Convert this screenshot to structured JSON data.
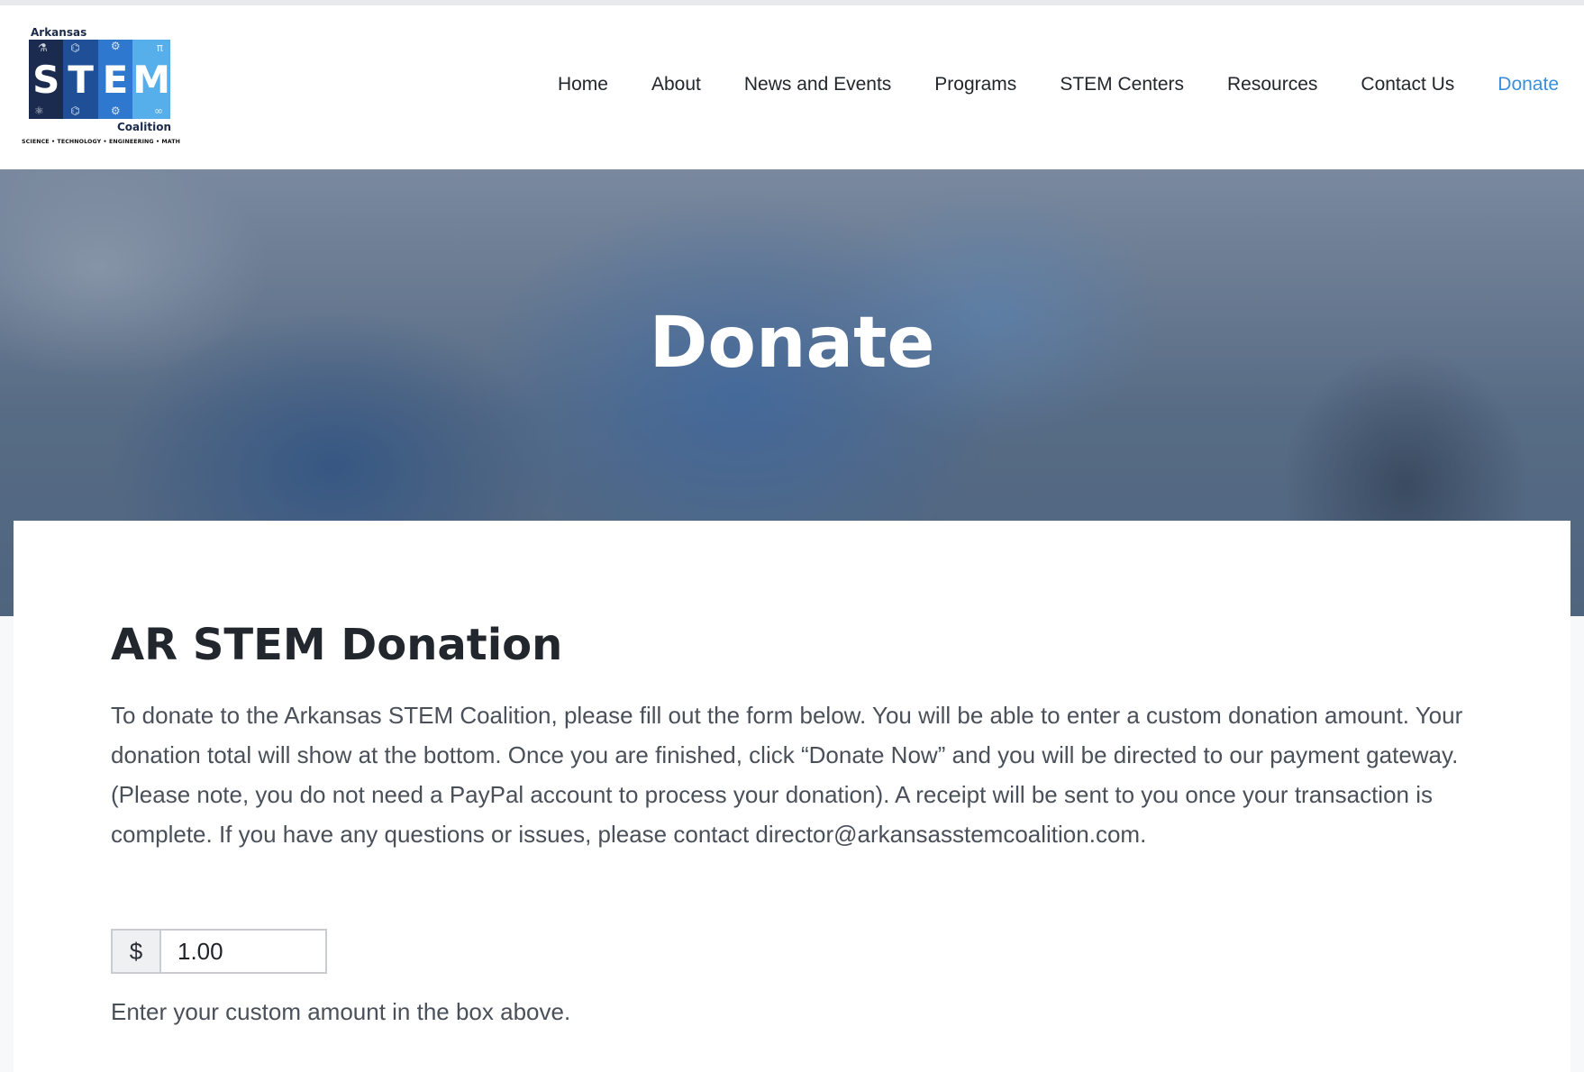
{
  "header": {
    "logo": {
      "top_text": "Arkansas",
      "letters": [
        "S",
        "T",
        "E",
        "M"
      ],
      "bottom_text": "Coalition",
      "tagline": "SCIENCE • TECHNOLOGY • ENGINEERING • MATH"
    },
    "nav": [
      {
        "label": "Home"
      },
      {
        "label": "About"
      },
      {
        "label": "News and Events"
      },
      {
        "label": "Programs"
      },
      {
        "label": "STEM Centers"
      },
      {
        "label": "Resources"
      },
      {
        "label": "Contact Us"
      },
      {
        "label": "Donate",
        "active": true
      }
    ],
    "active_color": "#3a8fdb"
  },
  "hero": {
    "title": "Donate"
  },
  "main": {
    "heading": "AR STEM Donation",
    "intro": "To donate to the Arkansas STEM Coalition, please fill out the form below. You will be able to enter a custom donation amount. Your donation total will show at the bottom. Once you are finished, click “Donate Now” and you will be directed to our payment gateway. (Please note, you do not need a PayPal account to process your donation). A receipt will be sent to you once your transaction is complete. If you have any questions or issues, please contact director@arkansasstemcoalition.com.",
    "amount": {
      "currency_symbol": "$",
      "value": "1.00",
      "help": "Enter your custom amount in the box above."
    }
  }
}
